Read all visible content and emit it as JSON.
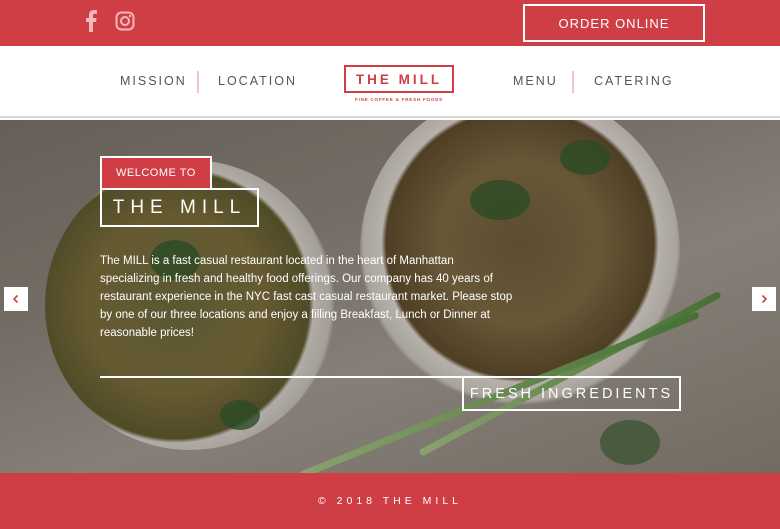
{
  "colors": {
    "brand": "#cf3e45",
    "white": "#ffffff",
    "nav_text": "#555555"
  },
  "topbar": {
    "social_icons": [
      "facebook-icon",
      "instagram-icon"
    ],
    "order_label": "ORDER ONLINE"
  },
  "nav": {
    "mission": "MISSION",
    "location": "LOCATION",
    "menu": "MENU",
    "catering": "CATERING"
  },
  "logo": {
    "name": "THE MILL",
    "tagline": "FINE COFFEE & FRESH FOODS"
  },
  "hero": {
    "welcome": "WELCOME TO",
    "title": "THE MILL",
    "description": "The MILL is a fast casual restaurant located in the heart of Manhattan specializing in fresh and healthy food offerings. Our company has 40 years of restaurant experience in the NYC fast cast casual restaurant market. Please stop by one of our three locations and enjoy a filling Breakfast, Lunch or Dinner at reasonable prices!",
    "tagline": "FRESH INGREDIENTS",
    "prev_icon": "chevron-left-icon",
    "next_icon": "chevron-right-icon"
  },
  "footer": {
    "copyright": "© 2018 THE MILL"
  }
}
